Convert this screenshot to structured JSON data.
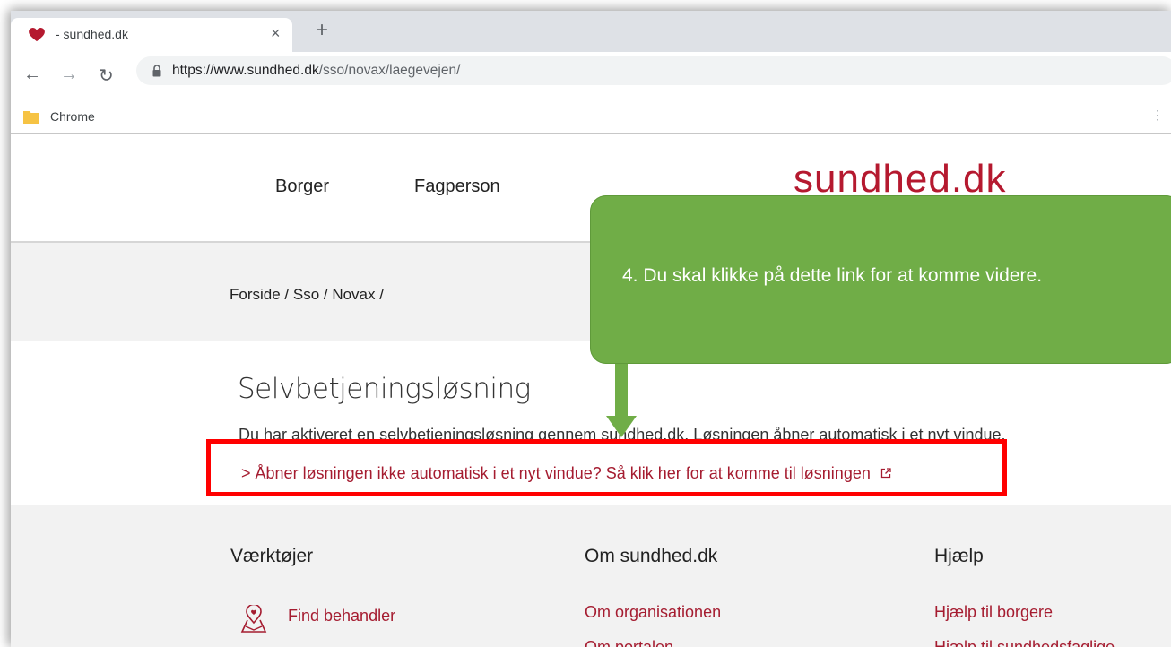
{
  "browser": {
    "tab_title": "- sundhed.dk",
    "new_tab": "+",
    "close": "×",
    "url_host": "https://www.sundhed.dk",
    "url_path": "/sso/novax/laegevejen/",
    "bookmark": "Chrome",
    "icons": {
      "favicon": "heart-icon",
      "lock": "lock-icon",
      "folder": "folder-icon"
    }
  },
  "header": {
    "nav": [
      "Borger",
      "Fagperson"
    ],
    "logo": "sundhed.dk",
    "brand_color": "#b5192f"
  },
  "breadcrumb": {
    "text": "Forside /  Sso /  Novax /"
  },
  "content": {
    "title": "Selvbetjeningsløsning",
    "intro": "Du har aktiveret en selvbetjeningsløsning gennem sundhed.dk. Løsningen åbner automatisk i et nyt vindue.",
    "link": "Åbner løsningen ikke automatisk i et nyt vindue? Så klik her for at komme til løsningen"
  },
  "footer": {
    "col1_title": "Værktøjer",
    "col1_link": "Find behandler",
    "col2_title": "Om sundhed.dk",
    "col2_link1": "Om organisationen",
    "col2_link2": "Om portalen",
    "col3_title": "Hjælp",
    "col3_link1": "Hjælp til borgere",
    "col3_link2": "Hjælp til sundhedsfaglige"
  },
  "annotation": {
    "callout": "4. Du skal klikke på dette link for at komme videre.",
    "callout_color": "#70ad47",
    "highlight_color": "#ff0000"
  }
}
